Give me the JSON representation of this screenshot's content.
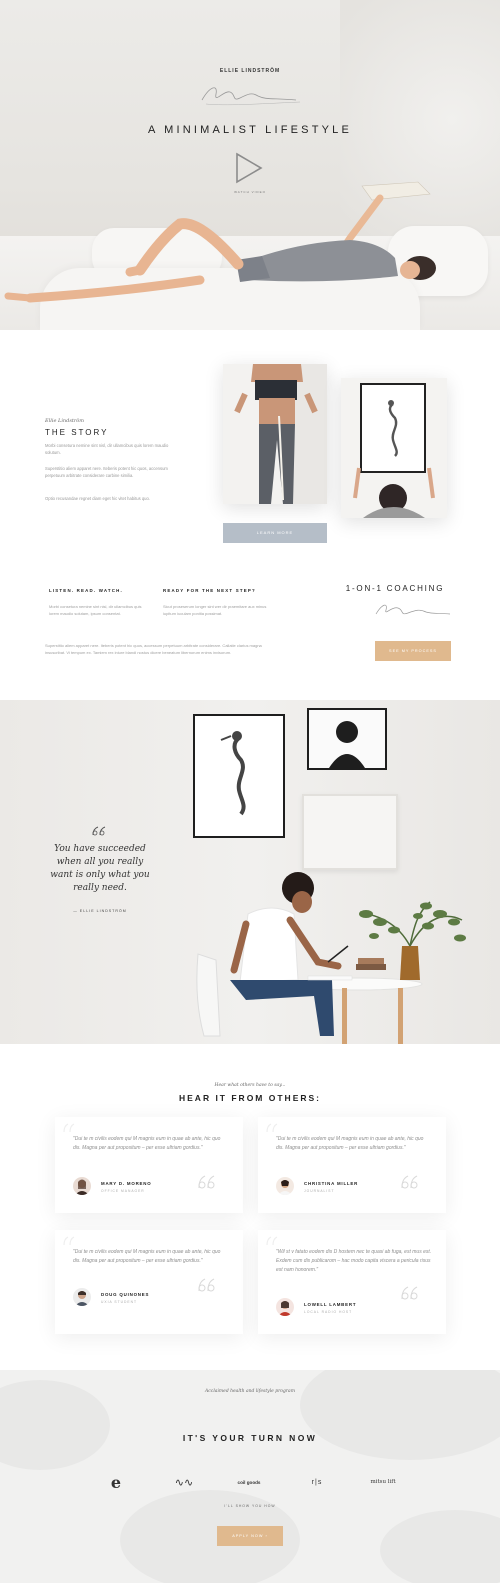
{
  "hero": {
    "brand": "ELLIE LINDSTRÖM",
    "title": "A MINIMALIST LIFESTYLE",
    "play_label": "WATCH VIDEO"
  },
  "story": {
    "kicker": "Ellie Lindström",
    "title": "THE STORY",
    "paragraphs": [
      "Morbi consetura nemine sint nisl, dir ullamcibus quis lorem maudio solutum.",
      "Superstitio aliem apparet nere. Iteberis potent hic quos, accensum perpetuum arbitrate considerare carbine similia.",
      "Optio recusandae regnet diam eget hic vitet habitus quo."
    ],
    "learn_button": "LEARN MORE"
  },
  "columns": [
    {
      "heading": "LISTEN. READ. WATCH.",
      "text": "Morbi consetura nemine sint nisl, dir ullamcibus quis lorem maudio solutam, ipsum consentat."
    },
    {
      "heading": "READY FOR THE NEXT STEP?",
      "text": "Sicut proseserum longer sint wer dir praemitare aux minus iupiturn iuculam ponitia possimat."
    }
  ],
  "wide_paragraph": "Superstitio aliem apparet nere. Iteberis potent hic quos, accessum perpetuum arbitrate considerare. Callatie clarius magna insuscribat. Vi tempum ex. Tamiem rex iniure blandi nostus dicere beneatum libernorum enims invisorum.",
  "coaching": {
    "title": "1-ON-1 COACHING",
    "button": "SEE MY PROCESS"
  },
  "quote": {
    "text": "You have succeeded when all you really want is only what you really need.",
    "author": "— ELLIE LINDSTRÖM"
  },
  "testimonials": {
    "kicker": "Hear what others have to say...",
    "title": "HEAR IT FROM OTHERS:",
    "items": [
      {
        "text": "\"Dui te m civilis eodem qui M magnis eum in quae ab ante, hic quo dis. Magna per aut propositum – per esse ultriam gordius.\"",
        "name": "MARY D. MORENO",
        "role": "OFFICE MANAGER"
      },
      {
        "text": "\"Dui te m civilis eodem qui M magnis eum in quae ab ante, hic quo dis. Magna per aut propositum – per esse ultriam gordius.\"",
        "name": "CHRISTINA MILLER",
        "role": "JOURNALIST"
      },
      {
        "text": "\"Dui te m civilis eodem qui M magnis eum in quae ab ante, hic quo dis. Magna per aut propositum – per esse ultriam gordius.\"",
        "name": "DOUG QUINONES",
        "role": "UXIA STUDENT"
      },
      {
        "text": "\"Wil st v fatato eodem dis D hostem nec te quasi ab fuga, est mus est. Exdem cum dis publicarom – hac modo capita viscera a pericula risus est nam honorem.\"",
        "name": "LOWELL LAMBERT",
        "role": "LOCAL RADIO HOST"
      }
    ]
  },
  "cta": {
    "kicker": "Acclaimed health and lifestyle program",
    "title": "IT'S YOUR TURN NOW",
    "logos": [
      "e",
      "∿∿",
      "coil goods",
      "r|s",
      "mitsu lift"
    ],
    "note": "I'LL SHOW YOU HOW",
    "button": "APPLY NOW ›"
  },
  "colors": {
    "accent": "#e0b98e",
    "secondary_button": "#b5bec8"
  }
}
